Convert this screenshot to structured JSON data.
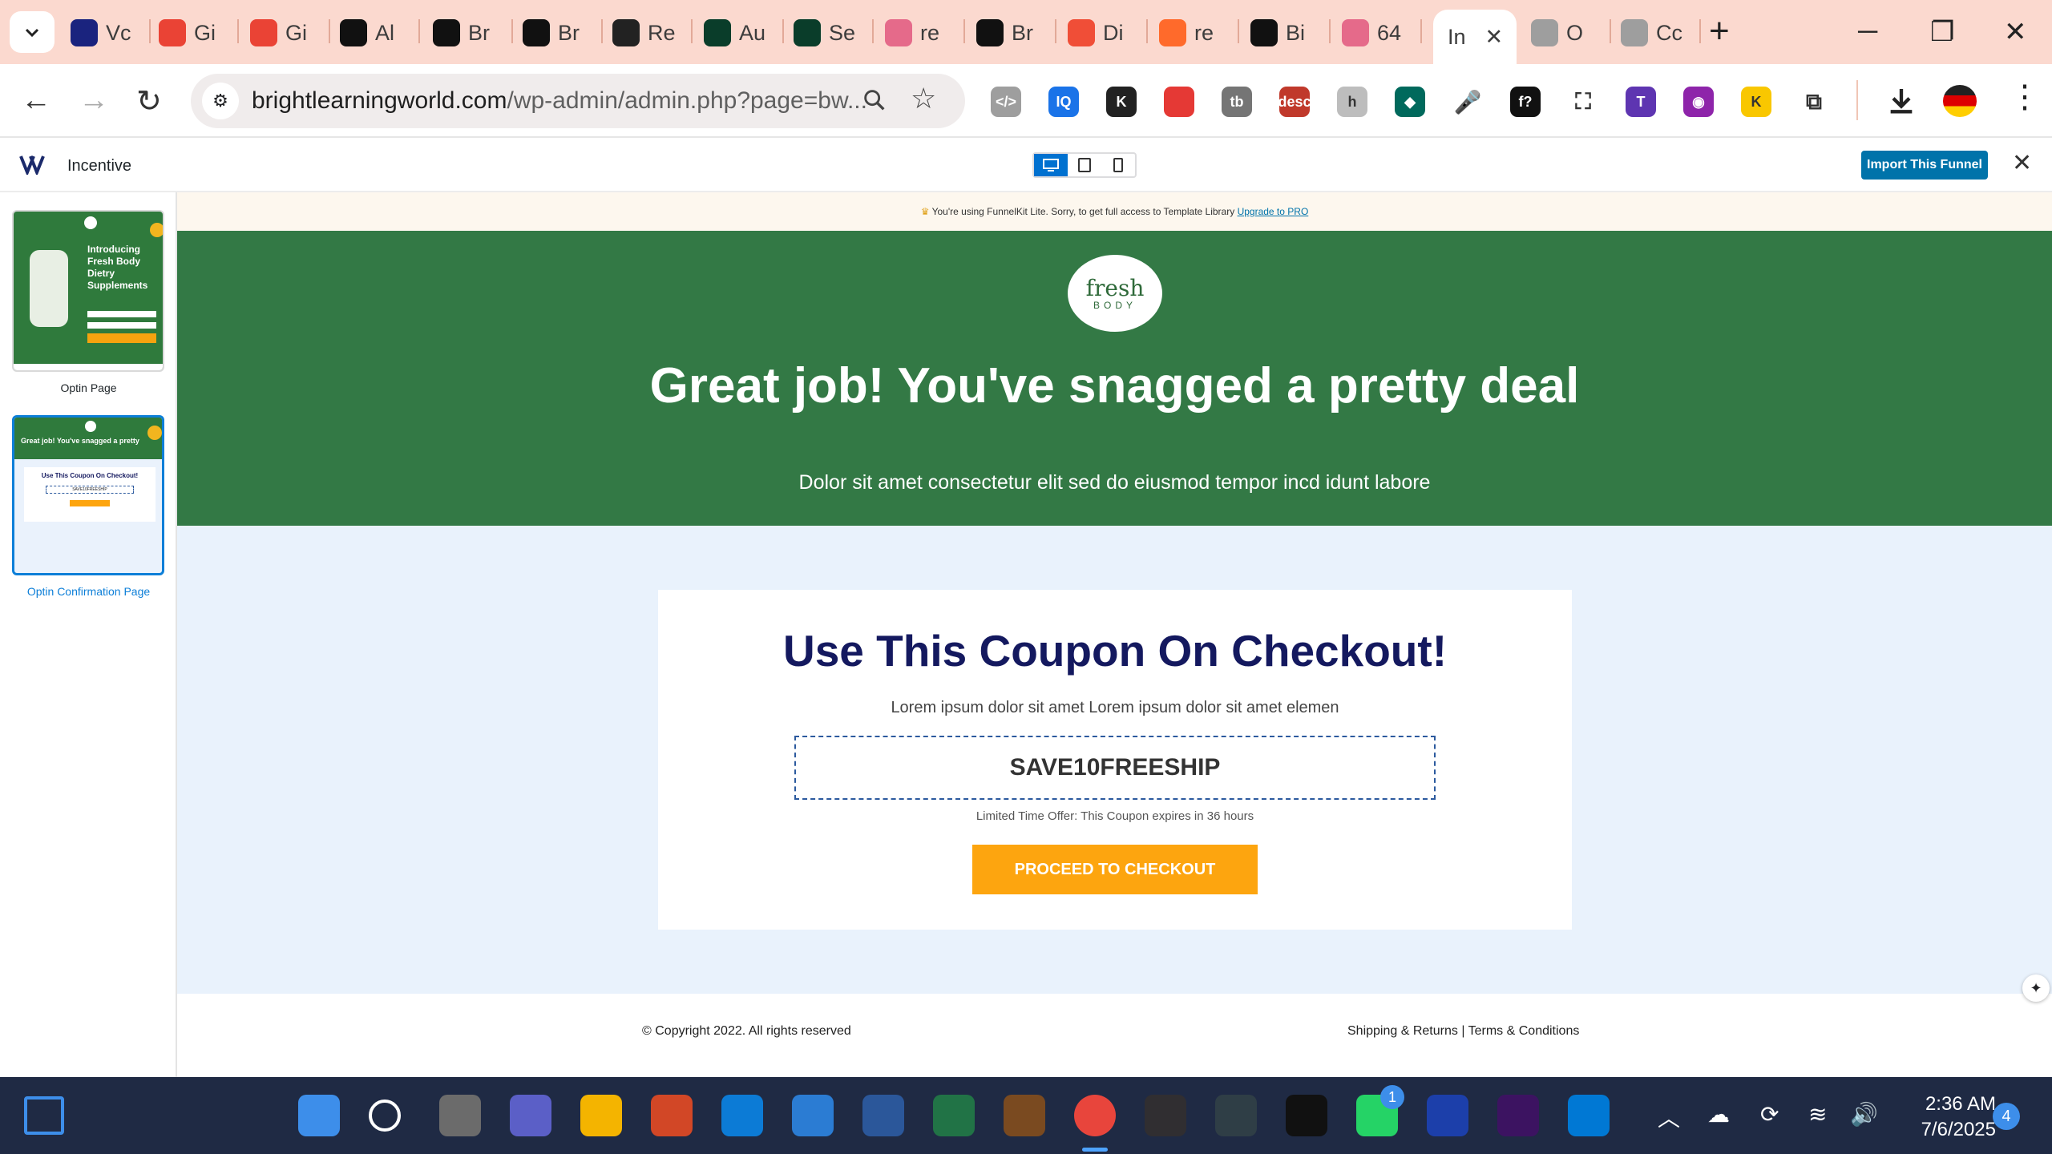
{
  "browser": {
    "tabs": [
      {
        "label": "Vc",
        "favicon": "vc-icon",
        "color": "#1a237e"
      },
      {
        "label": "Gi",
        "favicon": "gmail-icon",
        "color": "#ea4335"
      },
      {
        "label": "Gi",
        "favicon": "gmail-icon",
        "color": "#ea4335"
      },
      {
        "label": "Al",
        "favicon": "openai-icon",
        "color": "#111111"
      },
      {
        "label": "Br",
        "favicon": "github-icon",
        "color": "#111111"
      },
      {
        "label": "Br",
        "favicon": "github-icon",
        "color": "#111111"
      },
      {
        "label": "Re",
        "favicon": "ext-icon",
        "color": "#222222"
      },
      {
        "label": "Au",
        "favicon": "bolt-icon",
        "color": "#0a3d2a"
      },
      {
        "label": "Se",
        "favicon": "bolt-icon",
        "color": "#0a3d2a"
      },
      {
        "label": "re",
        "favicon": "heart-icon",
        "color": "#e56a8a"
      },
      {
        "label": "Br",
        "favicon": "github-icon",
        "color": "#111111"
      },
      {
        "label": "Di",
        "favicon": "doc-icon",
        "color": "#f04e37"
      },
      {
        "label": "re",
        "favicon": "zapier-icon",
        "color": "#ff6a2b"
      },
      {
        "label": "Bi",
        "favicon": "github-icon",
        "color": "#111111"
      },
      {
        "label": "64",
        "favicon": "heart-icon",
        "color": "#e56a8a"
      },
      {
        "label": "In",
        "favicon": "",
        "color": "#ffffff",
        "active": true
      },
      {
        "label": "O",
        "favicon": "avatar-icon",
        "color": "#9e9e9e"
      },
      {
        "label": "Cc",
        "favicon": "avatar-icon",
        "color": "#9e9e9e"
      }
    ],
    "url_main": "brightlearningworld.com",
    "url_path": "/wp-admin/admin.php?page=bw...",
    "extensions": [
      {
        "name": "code-ext-icon",
        "color": "#9e9e9e",
        "glyph": "</>"
      },
      {
        "name": "iq-ext-icon",
        "color": "#1a73e8",
        "glyph": "IQ"
      },
      {
        "name": "k-ext-icon",
        "color": "#222222",
        "glyph": "K"
      },
      {
        "name": "grid-ext-icon",
        "color": "#e53935",
        "glyph": ""
      },
      {
        "name": "tb-ext-icon",
        "color": "#757575",
        "glyph": "tb"
      },
      {
        "name": "desc-ext-icon",
        "color": "#c0392b",
        "glyph": "desc"
      },
      {
        "name": "h-ext-icon",
        "color": "#bdbdbd",
        "glyph": "h"
      },
      {
        "name": "diamond-ext-icon",
        "color": "#00695c",
        "glyph": "◆"
      },
      {
        "name": "mic-ext-icon",
        "color": "#ffffff",
        "glyph": "🎤"
      },
      {
        "name": "f-ext-icon",
        "color": "#111111",
        "glyph": "f?"
      },
      {
        "name": "expand-ext-icon",
        "color": "#ffffff",
        "glyph": "⛶"
      },
      {
        "name": "t-ext-icon",
        "color": "#5e35b1",
        "glyph": "T"
      },
      {
        "name": "eye-ext-icon",
        "color": "#8e24aa",
        "glyph": "◉"
      },
      {
        "name": "k2-ext-icon",
        "color": "#f9c700",
        "glyph": "K"
      },
      {
        "name": "puzzle-ext-icon",
        "color": "#ffffff",
        "glyph": "⧉"
      }
    ]
  },
  "builder": {
    "title": "Incentive",
    "import_label": "Import This Funnel",
    "pages": [
      {
        "label": "Optin Page",
        "active": false,
        "heading": "Introducing Fresh Body Dietry Supplements"
      },
      {
        "label": "Optin Confirmation Page",
        "active": true,
        "heading": "Great job! You've snagged a pretty",
        "card_title": "Use This Coupon On Checkout!",
        "code": "SAVE10FREESHIP"
      }
    ]
  },
  "notice": {
    "text": "You're using FunnelKit Lite. Sorry, to get full access to Template Library",
    "link": "Upgrade to PRO"
  },
  "hero": {
    "logo_top": "fresh",
    "logo_bottom": "BODY",
    "title": "Great job! You've snagged a pretty deal",
    "subtitle": "Dolor sit amet consectetur elit sed do eiusmod tempor incd idunt labore"
  },
  "coupon_card": {
    "title": "Use This Coupon On Checkout!",
    "subtitle": "Lorem ipsum dolor sit amet Lorem ipsum dolor sit amet elemen",
    "code": "SAVE10FREESHIP",
    "expires": "Limited Time Offer: This Coupon expires in 36 hours",
    "button": "PROCEED TO CHECKOUT"
  },
  "footer": {
    "copyright": "© Copyright 2022. All rights reserved",
    "link1": "Shipping & Returns",
    "divider": "|",
    "link2": "Terms & Conditions"
  },
  "taskbar": {
    "apps": [
      {
        "name": "start-icon",
        "color": "#3d8eea"
      },
      {
        "name": "search-icon",
        "color": "transparent"
      },
      {
        "name": "task-view-icon",
        "color": "#6b6b6b"
      },
      {
        "name": "meet-icon",
        "color": "#5b5fc7"
      },
      {
        "name": "file-explorer-icon",
        "color": "#f4b400"
      },
      {
        "name": "powerpoint-icon",
        "color": "#d24726"
      },
      {
        "name": "edge-icon",
        "color": "#0c7bd6"
      },
      {
        "name": "store-icon",
        "color": "#2b7cd3"
      },
      {
        "name": "word-icon",
        "color": "#2b579a"
      },
      {
        "name": "excel-icon",
        "color": "#217346"
      },
      {
        "name": "fruit-app-icon",
        "color": "#7a4a20"
      },
      {
        "name": "chrome-icon",
        "color": "#e8453c"
      },
      {
        "name": "obs-icon",
        "color": "#302e31"
      },
      {
        "name": "filmora-icon",
        "color": "#2f3e46"
      },
      {
        "name": "capcut-icon",
        "color": "#111111"
      },
      {
        "name": "whatsapp-icon",
        "color": "#25d366"
      },
      {
        "name": "vpn-icon",
        "color": "#1c3faa"
      },
      {
        "name": "premiere-icon",
        "color": "#3c1361"
      },
      {
        "name": "vscode-icon",
        "color": "#0078d4"
      }
    ],
    "whatsapp_badge": "1",
    "time": "2:36 AM",
    "date": "7/6/2025",
    "notifications": "4"
  }
}
